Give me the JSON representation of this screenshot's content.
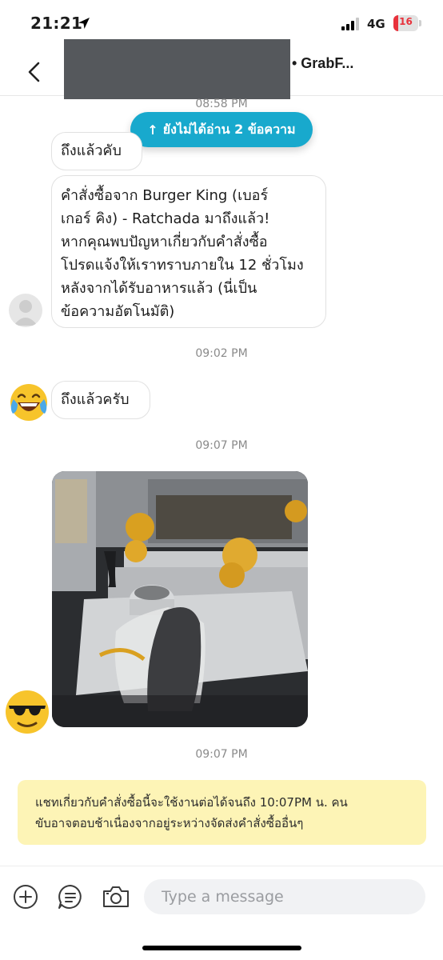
{
  "status_bar": {
    "time": "21:21",
    "network": "4G",
    "battery_level": "16",
    "icons": [
      "location-arrow-icon",
      "signal-icon",
      "battery-icon"
    ]
  },
  "header": {
    "title": "• GrabF...",
    "icons": [
      "chevron-left-icon"
    ]
  },
  "unread_banner": {
    "arrow": "↑",
    "label": "ยังไม่ได้อ่าน 2 ข้อความ"
  },
  "messages": [
    {
      "time": "08:58 PM"
    },
    {
      "text": "ถึงแล้วคับ"
    },
    {
      "text_lines": [
        "คำสั่งซื้อจาก Burger King (เบอร์",
        "เกอร์ คิง) - Ratchada มาถึงแล้ว!",
        "หากคุณพบปัญหาเกี่ยวกับคำสั่งซื้อ",
        "โปรดแจ้งให้เราทราบภายใน 12 ชั่วโมง",
        "หลังจากได้รับอาหารแล้ว (นี่เป็น",
        "ข้อความอัตโนมัติ)"
      ]
    },
    {
      "time": "09:02 PM"
    },
    {
      "text": "ถึงแล้วครับ"
    },
    {
      "time": "09:07 PM"
    },
    {
      "time": "09:07 PM"
    }
  ],
  "avatars": [
    "default-avatar-icon",
    "laughing-tears-emoji",
    "sunglasses-emoji"
  ],
  "notice": {
    "lines": [
      "แชทเกี่ยวกับคำสั่งซื้อนี้จะใช้งานต่อได้จนถึง 10:07PM น. คน",
      "ขับอาจตอบช้าเนื่องจากอยู่ระหว่างจัดส่งคำสั่งซื้ออื่นๆ"
    ]
  },
  "composer": {
    "placeholder": "Type a message",
    "icons": [
      "plus-circle-icon",
      "quick-reply-icon",
      "camera-icon"
    ]
  },
  "colors": {
    "accent": "#18a9cd",
    "notice_bg": "#fdf4b6",
    "timestamp": "#8a8a8a"
  }
}
